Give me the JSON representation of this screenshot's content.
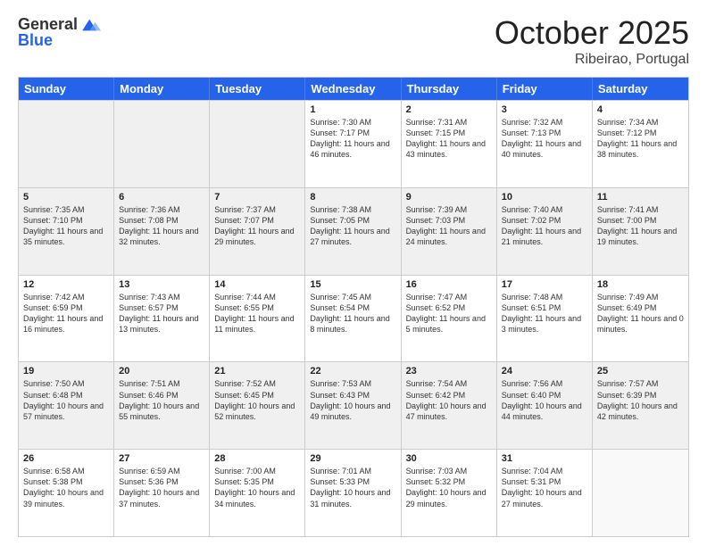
{
  "header": {
    "logo_general": "General",
    "logo_blue": "Blue",
    "month_title": "October 2025",
    "location": "Ribeirao, Portugal"
  },
  "days_of_week": [
    "Sunday",
    "Monday",
    "Tuesday",
    "Wednesday",
    "Thursday",
    "Friday",
    "Saturday"
  ],
  "weeks": [
    [
      {
        "day": "",
        "text": "",
        "shaded": true,
        "empty": true
      },
      {
        "day": "",
        "text": "",
        "shaded": true,
        "empty": true
      },
      {
        "day": "",
        "text": "",
        "shaded": true,
        "empty": true
      },
      {
        "day": "1",
        "text": "Sunrise: 7:30 AM\nSunset: 7:17 PM\nDaylight: 11 hours and 46 minutes.",
        "shaded": false
      },
      {
        "day": "2",
        "text": "Sunrise: 7:31 AM\nSunset: 7:15 PM\nDaylight: 11 hours and 43 minutes.",
        "shaded": false
      },
      {
        "day": "3",
        "text": "Sunrise: 7:32 AM\nSunset: 7:13 PM\nDaylight: 11 hours and 40 minutes.",
        "shaded": false
      },
      {
        "day": "4",
        "text": "Sunrise: 7:34 AM\nSunset: 7:12 PM\nDaylight: 11 hours and 38 minutes.",
        "shaded": false
      }
    ],
    [
      {
        "day": "5",
        "text": "Sunrise: 7:35 AM\nSunset: 7:10 PM\nDaylight: 11 hours and 35 minutes.",
        "shaded": true
      },
      {
        "day": "6",
        "text": "Sunrise: 7:36 AM\nSunset: 7:08 PM\nDaylight: 11 hours and 32 minutes.",
        "shaded": true
      },
      {
        "day": "7",
        "text": "Sunrise: 7:37 AM\nSunset: 7:07 PM\nDaylight: 11 hours and 29 minutes.",
        "shaded": true
      },
      {
        "day": "8",
        "text": "Sunrise: 7:38 AM\nSunset: 7:05 PM\nDaylight: 11 hours and 27 minutes.",
        "shaded": true
      },
      {
        "day": "9",
        "text": "Sunrise: 7:39 AM\nSunset: 7:03 PM\nDaylight: 11 hours and 24 minutes.",
        "shaded": true
      },
      {
        "day": "10",
        "text": "Sunrise: 7:40 AM\nSunset: 7:02 PM\nDaylight: 11 hours and 21 minutes.",
        "shaded": true
      },
      {
        "day": "11",
        "text": "Sunrise: 7:41 AM\nSunset: 7:00 PM\nDaylight: 11 hours and 19 minutes.",
        "shaded": true
      }
    ],
    [
      {
        "day": "12",
        "text": "Sunrise: 7:42 AM\nSunset: 6:59 PM\nDaylight: 11 hours and 16 minutes.",
        "shaded": false
      },
      {
        "day": "13",
        "text": "Sunrise: 7:43 AM\nSunset: 6:57 PM\nDaylight: 11 hours and 13 minutes.",
        "shaded": false
      },
      {
        "day": "14",
        "text": "Sunrise: 7:44 AM\nSunset: 6:55 PM\nDaylight: 11 hours and 11 minutes.",
        "shaded": false
      },
      {
        "day": "15",
        "text": "Sunrise: 7:45 AM\nSunset: 6:54 PM\nDaylight: 11 hours and 8 minutes.",
        "shaded": false
      },
      {
        "day": "16",
        "text": "Sunrise: 7:47 AM\nSunset: 6:52 PM\nDaylight: 11 hours and 5 minutes.",
        "shaded": false
      },
      {
        "day": "17",
        "text": "Sunrise: 7:48 AM\nSunset: 6:51 PM\nDaylight: 11 hours and 3 minutes.",
        "shaded": false
      },
      {
        "day": "18",
        "text": "Sunrise: 7:49 AM\nSunset: 6:49 PM\nDaylight: 11 hours and 0 minutes.",
        "shaded": false
      }
    ],
    [
      {
        "day": "19",
        "text": "Sunrise: 7:50 AM\nSunset: 6:48 PM\nDaylight: 10 hours and 57 minutes.",
        "shaded": true
      },
      {
        "day": "20",
        "text": "Sunrise: 7:51 AM\nSunset: 6:46 PM\nDaylight: 10 hours and 55 minutes.",
        "shaded": true
      },
      {
        "day": "21",
        "text": "Sunrise: 7:52 AM\nSunset: 6:45 PM\nDaylight: 10 hours and 52 minutes.",
        "shaded": true
      },
      {
        "day": "22",
        "text": "Sunrise: 7:53 AM\nSunset: 6:43 PM\nDaylight: 10 hours and 49 minutes.",
        "shaded": true
      },
      {
        "day": "23",
        "text": "Sunrise: 7:54 AM\nSunset: 6:42 PM\nDaylight: 10 hours and 47 minutes.",
        "shaded": true
      },
      {
        "day": "24",
        "text": "Sunrise: 7:56 AM\nSunset: 6:40 PM\nDaylight: 10 hours and 44 minutes.",
        "shaded": true
      },
      {
        "day": "25",
        "text": "Sunrise: 7:57 AM\nSunset: 6:39 PM\nDaylight: 10 hours and 42 minutes.",
        "shaded": true
      }
    ],
    [
      {
        "day": "26",
        "text": "Sunrise: 6:58 AM\nSunset: 5:38 PM\nDaylight: 10 hours and 39 minutes.",
        "shaded": false
      },
      {
        "day": "27",
        "text": "Sunrise: 6:59 AM\nSunset: 5:36 PM\nDaylight: 10 hours and 37 minutes.",
        "shaded": false
      },
      {
        "day": "28",
        "text": "Sunrise: 7:00 AM\nSunset: 5:35 PM\nDaylight: 10 hours and 34 minutes.",
        "shaded": false
      },
      {
        "day": "29",
        "text": "Sunrise: 7:01 AM\nSunset: 5:33 PM\nDaylight: 10 hours and 31 minutes.",
        "shaded": false
      },
      {
        "day": "30",
        "text": "Sunrise: 7:03 AM\nSunset: 5:32 PM\nDaylight: 10 hours and 29 minutes.",
        "shaded": false
      },
      {
        "day": "31",
        "text": "Sunrise: 7:04 AM\nSunset: 5:31 PM\nDaylight: 10 hours and 27 minutes.",
        "shaded": false
      },
      {
        "day": "",
        "text": "",
        "shaded": false,
        "empty": true
      }
    ]
  ]
}
